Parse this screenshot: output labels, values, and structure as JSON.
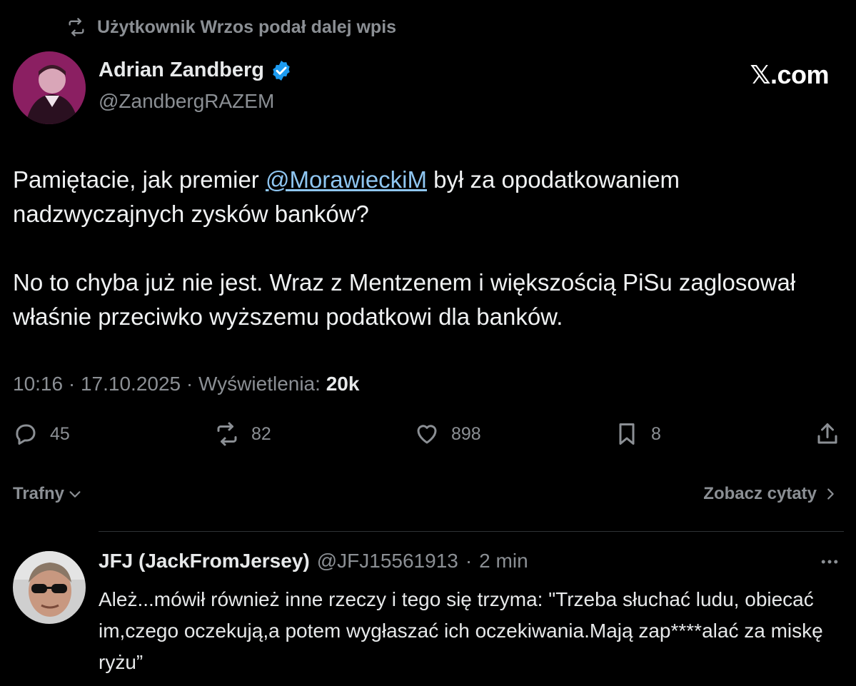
{
  "retweet_banner": {
    "icon": "retweet-icon",
    "text": "Użytkownik Wrzos podał dalej wpis"
  },
  "author": {
    "name": "Adrian Zandberg",
    "handle": "@ZandbergRAZEM",
    "verified": true,
    "verified_color": "#1d9bf0"
  },
  "brand": {
    "logo_text": "𝕏.com"
  },
  "tweet": {
    "p1_before": "Pamiętacie, jak premier ",
    "mention": "@MorawieckiM",
    "p1_after": " był za opodatkowaniem nadzwyczajnych zysków banków?",
    "p2": "No to chyba już nie jest. Wraz z Mentzenem i większością PiSu zaglosował właśnie przeciwko wyższemu podatkowi dla banków."
  },
  "meta": {
    "time": "10:16",
    "date": "17.10.2025",
    "views_label": "Wyświetlenia:",
    "views": "20k",
    "separator": "·"
  },
  "actions": {
    "replies": "45",
    "retweets": "82",
    "likes": "898",
    "bookmarks": "8"
  },
  "filters": {
    "sort_label": "Trafny",
    "quotes_label": "Zobacz cytaty"
  },
  "reply": {
    "name": "JFJ (JackFromJersey)",
    "handle": "@JFJ15561913",
    "separator": "·",
    "time": "2 min",
    "text": "Ależ...mówił również inne rzeczy i tego się trzyma: \"Trzeba słuchać ludu, obiecać im,czego oczekują,a potem wygłaszać ich oczekiwania.Mają zap****alać za miskę ryżu”"
  },
  "colors": {
    "background": "#000000",
    "text": "#e7e9ea",
    "muted": "#8b8f94",
    "link": "#8fc6f1",
    "divider": "#2f3336"
  }
}
